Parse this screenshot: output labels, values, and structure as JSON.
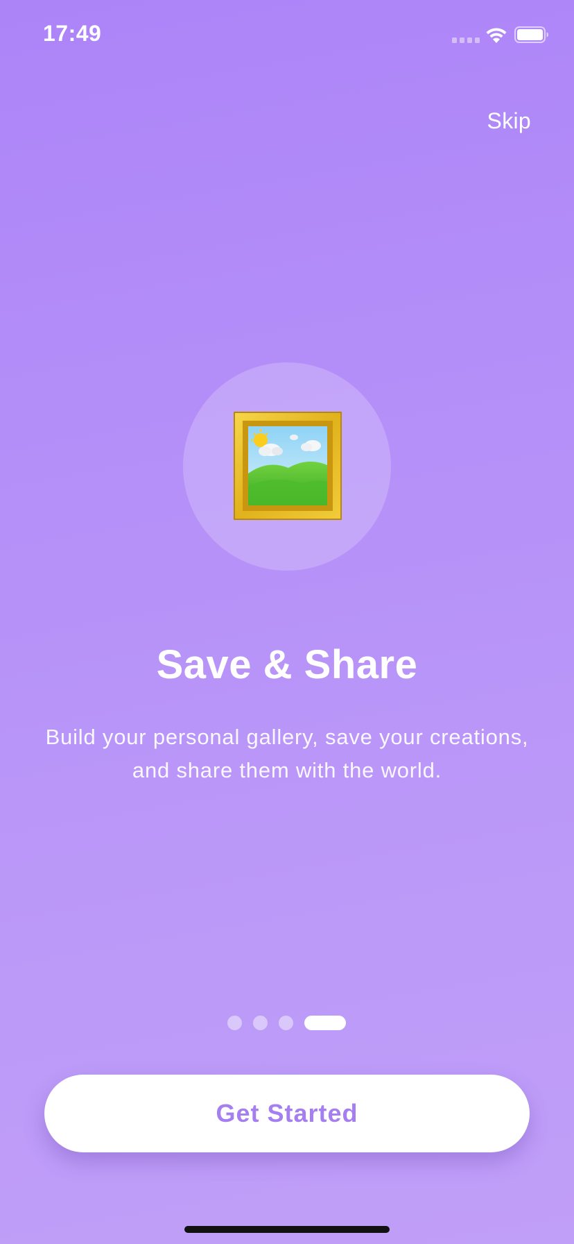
{
  "status_bar": {
    "time": "17:49",
    "icons": [
      "cellular-signal-icon",
      "wifi-icon",
      "battery-icon"
    ]
  },
  "header": {
    "skip_label": "Skip"
  },
  "hero": {
    "icon": "framed-picture-icon"
  },
  "content": {
    "title": "Save & Share",
    "description": "Build your personal gallery, save your creations, and share them with the world."
  },
  "pager": {
    "total_pages": 4,
    "current_page": 4
  },
  "cta": {
    "label": "Get Started"
  },
  "colors": {
    "background_start": "#ad84f8",
    "background_end": "#c09ff8",
    "accent": "#a57ef0",
    "button_bg": "#ffffff"
  }
}
